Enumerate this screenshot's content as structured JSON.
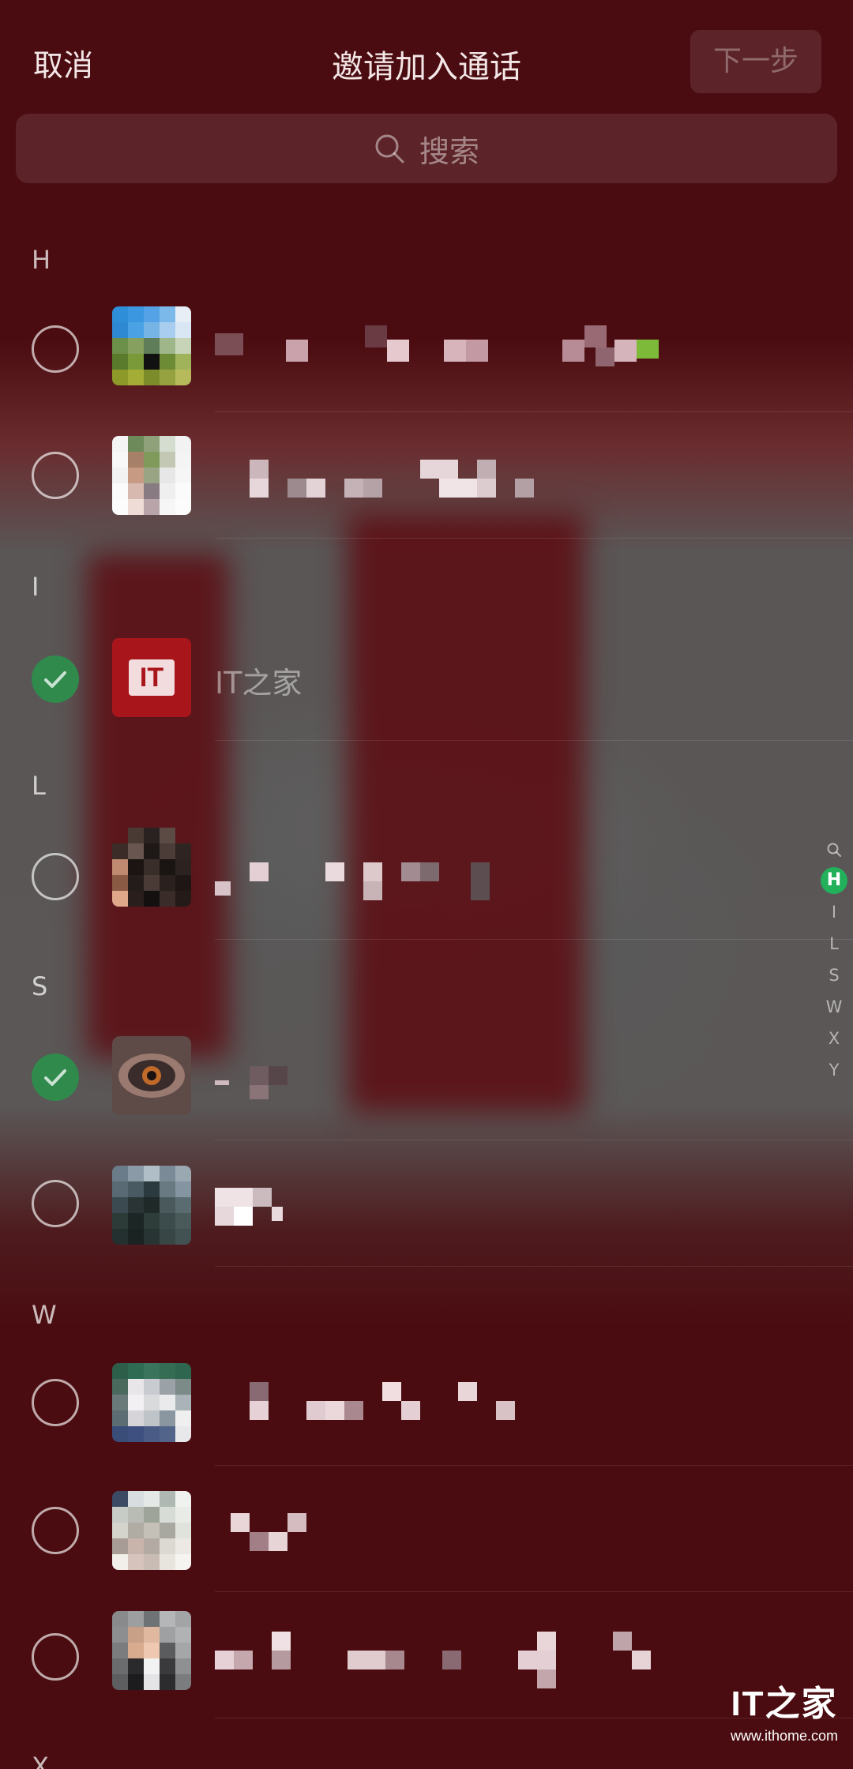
{
  "header": {
    "cancel_label": "取消",
    "title": "邀请加入通话",
    "next_label": "下一步"
  },
  "search": {
    "placeholder": "搜索",
    "icon": "search-icon"
  },
  "sections": [
    {
      "letter": "H",
      "contacts": [
        {
          "name": "",
          "selected": false,
          "name_hidden": true
        },
        {
          "name": "",
          "selected": false,
          "name_hidden": true
        }
      ]
    },
    {
      "letter": "I",
      "contacts": [
        {
          "name": "IT之家",
          "selected": true,
          "name_hidden": false
        }
      ]
    },
    {
      "letter": "L",
      "contacts": [
        {
          "name": "",
          "selected": false,
          "name_hidden": true
        }
      ]
    },
    {
      "letter": "S",
      "contacts": [
        {
          "name": "",
          "selected": true,
          "name_hidden": true
        },
        {
          "name": "",
          "selected": false,
          "name_hidden": true
        }
      ]
    },
    {
      "letter": "W",
      "contacts": [
        {
          "name": "",
          "selected": false,
          "name_hidden": true
        },
        {
          "name": "",
          "selected": false,
          "name_hidden": true
        },
        {
          "name": "",
          "selected": false,
          "name_hidden": true
        }
      ]
    },
    {
      "letter": "X",
      "contacts": []
    }
  ],
  "index_bar": [
    "Q",
    "H",
    "I",
    "L",
    "S",
    "W",
    "X",
    "Y"
  ],
  "index_active": "H",
  "watermark": {
    "logo": "IT之家",
    "url": "www.ithome.com"
  },
  "colors": {
    "selected_check": "#2f8a4c",
    "index_active": "#22b05a",
    "background": "#4a0c10"
  }
}
